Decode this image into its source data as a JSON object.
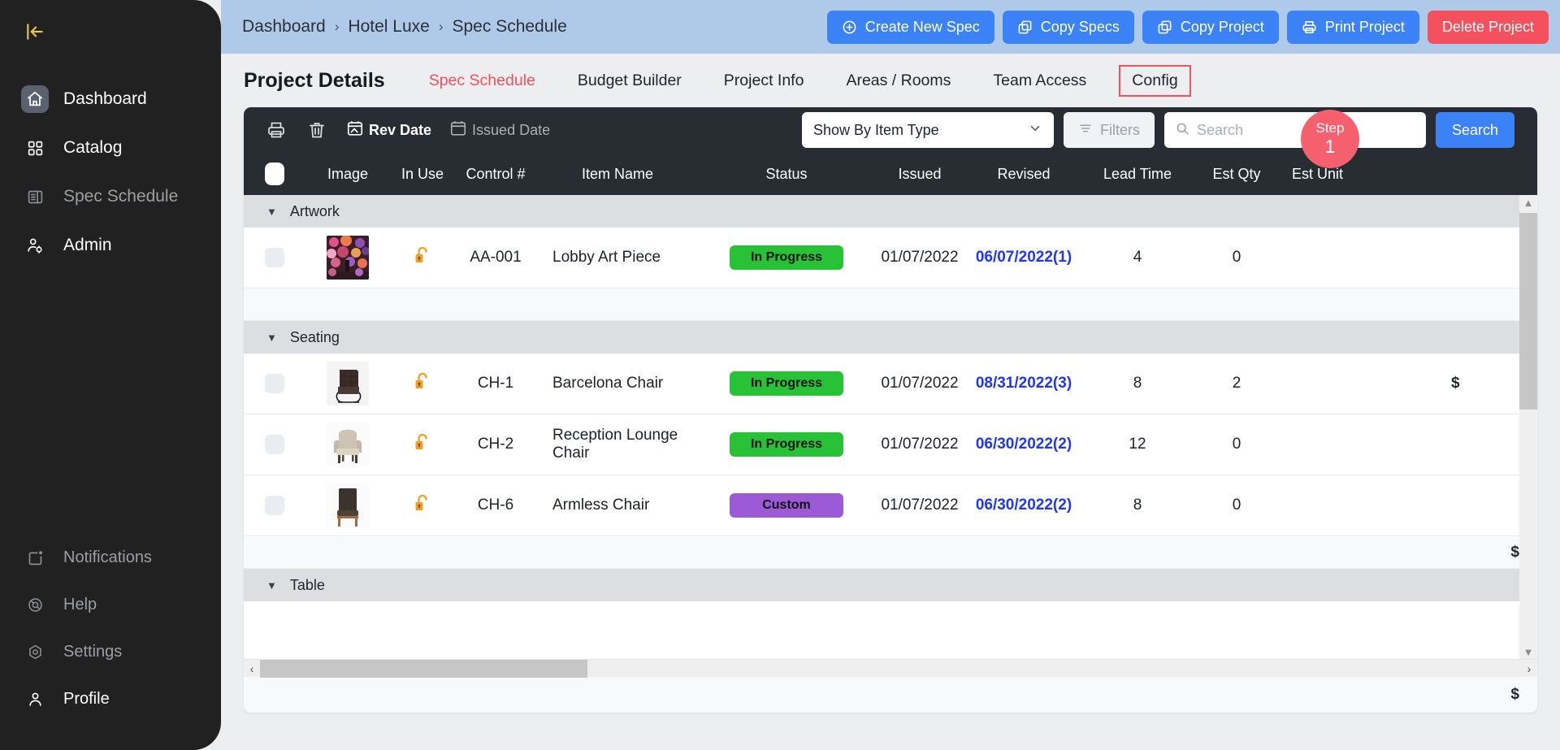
{
  "sidebar": {
    "collapse_icon": "collapse-panel-icon",
    "top_items": [
      {
        "label": "Dashboard",
        "icon": "home-icon",
        "state": "active"
      },
      {
        "label": "Catalog",
        "icon": "grid-icon",
        "state": "bright"
      },
      {
        "label": "Spec Schedule",
        "icon": "document-list-icon",
        "state": "dim"
      },
      {
        "label": "Admin",
        "icon": "user-gear-icon",
        "state": "bright"
      }
    ],
    "bottom_items": [
      {
        "label": "Notifications",
        "icon": "bell-dot-icon",
        "state": "dim"
      },
      {
        "label": "Help",
        "icon": "lifebuoy-icon",
        "state": "dim"
      },
      {
        "label": "Settings",
        "icon": "gear-icon",
        "state": "dim"
      },
      {
        "label": "Profile",
        "icon": "user-icon",
        "state": "bright"
      }
    ]
  },
  "header": {
    "breadcrumb": [
      "Dashboard",
      "Hotel Luxe",
      "Spec Schedule"
    ],
    "separator": "›",
    "actions": [
      {
        "label": "Create New Spec",
        "icon": "plus-circle-icon",
        "style": "primary"
      },
      {
        "label": "Copy Specs",
        "icon": "copy-icon",
        "style": "primary"
      },
      {
        "label": "Copy Project",
        "icon": "copy-icon",
        "style": "primary"
      },
      {
        "label": "Print Project",
        "icon": "printer-icon",
        "style": "primary"
      },
      {
        "label": "Delete Project",
        "icon": "none",
        "style": "danger"
      }
    ]
  },
  "tabs": {
    "page_title": "Project Details",
    "items": [
      {
        "label": "Spec Schedule",
        "active": true
      },
      {
        "label": "Budget Builder",
        "active": false
      },
      {
        "label": "Project Info",
        "active": false
      },
      {
        "label": "Areas / Rooms",
        "active": false
      },
      {
        "label": "Team Access",
        "active": false
      },
      {
        "label": "Config",
        "active": false,
        "outlined": true
      }
    ],
    "step_badge": {
      "word": "Step",
      "number": "1"
    }
  },
  "toolbar": {
    "print_icon": "printer-icon",
    "delete_icon": "trash-icon",
    "rev_date_label": "Rev Date",
    "rev_date_icon": "calendar-image-icon",
    "issued_date_label": "Issued Date",
    "issued_date_icon": "calendar-icon",
    "select_value": "Show By Item Type",
    "filters_label": "Filters",
    "filters_icon": "filter-icon",
    "search_placeholder": "Search",
    "search_value": "",
    "search_icon": "search-icon",
    "search_button": "Search"
  },
  "table": {
    "columns": [
      "",
      "Image",
      "In Use",
      "Control #",
      "Item Name",
      "Status",
      "Issued",
      "Revised",
      "Lead Time",
      "Est Qty",
      "Est Unit"
    ],
    "groups": [
      {
        "name": "Artwork",
        "rows": [
          {
            "image": "artwork-thumbnail",
            "in_use": "unlocked-padlock-icon",
            "control": "AA-001",
            "item_name": "Lobby Art Piece",
            "status": "In Progress",
            "status_color": "green",
            "issued": "01/07/2022",
            "revised": "06/07/2022(1)",
            "lead_time": "4",
            "est_qty": "0",
            "est_unit": ""
          }
        ],
        "subtotal": ""
      },
      {
        "name": "Seating",
        "rows": [
          {
            "image": "barcelona-chair-thumbnail",
            "in_use": "unlocked-padlock-icon",
            "control": "CH-1",
            "item_name": "Barcelona Chair",
            "status": "In Progress",
            "status_color": "green",
            "issued": "01/07/2022",
            "revised": "08/31/2022(3)",
            "lead_time": "8",
            "est_qty": "2",
            "est_unit": "$"
          },
          {
            "image": "lounge-chair-thumbnail",
            "in_use": "unlocked-padlock-icon",
            "control": "CH-2",
            "item_name": "Reception Lounge Chair",
            "status": "In Progress",
            "status_color": "green",
            "issued": "01/07/2022",
            "revised": "06/30/2022(2)",
            "lead_time": "12",
            "est_qty": "0",
            "est_unit": ""
          },
          {
            "image": "armless-chair-thumbnail",
            "in_use": "unlocked-padlock-icon",
            "control": "CH-6",
            "item_name": "Armless Chair",
            "status": "Custom",
            "status_color": "purple",
            "issued": "01/07/2022",
            "revised": "06/30/2022(2)",
            "lead_time": "8",
            "est_qty": "0",
            "est_unit": ""
          }
        ],
        "subtotal": "$"
      },
      {
        "name": "Table",
        "rows": [],
        "subtotal": ""
      }
    ],
    "grand_total": "$"
  },
  "colors": {
    "primary": "#3b82f6",
    "danger": "#f4505e",
    "accent_red": "#f4505e",
    "header_bg": "#afc9e8",
    "sidebar_bg": "#212121",
    "toolbar_bg": "#272d33",
    "status_green": "#28c236",
    "status_purple": "#9c5ad6",
    "link_blue": "#1f37f2"
  }
}
